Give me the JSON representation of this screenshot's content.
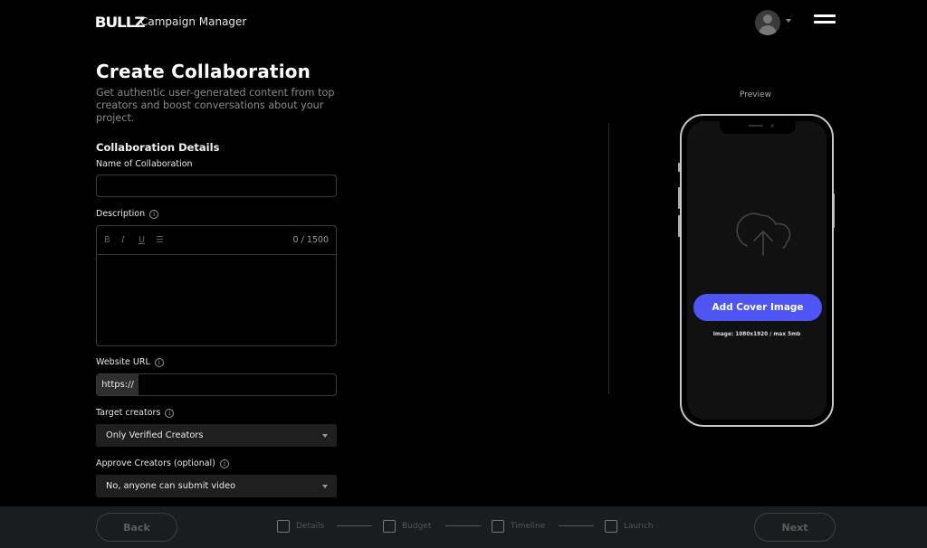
{
  "header": {
    "logo": "BULLZ",
    "app_title": "Campaign Manager"
  },
  "form": {
    "title": "Create Collaboration",
    "subtitle": "Get authentic user-generated content from top creators and boost conversations about your project.",
    "section_title": "Collaboration Details",
    "name_label": "Name of Collaboration",
    "name_value": "",
    "description_label": "Description",
    "description_toolbar": [
      "B",
      "I",
      "U",
      "☰"
    ],
    "description_counter": "0 / 1500",
    "description_value": "",
    "website_label": "Website URL",
    "website_prefix": "https://",
    "website_value": "",
    "target_label": "Target creators",
    "target_value": "Only Verified Creators",
    "approve_label": "Approve Creators (optional)",
    "approve_value": "No, anyone can submit video",
    "info_glyph": "i"
  },
  "preview": {
    "label": "Preview",
    "cover_button": "Add Cover Image",
    "cover_hint": "Image: 1080x1920 / max 5mb",
    "accent_color": "#4f55f5"
  },
  "footer": {
    "back_label": "Back",
    "next_label": "Next",
    "steps": [
      {
        "label": "Details",
        "checked": false
      },
      {
        "label": "Budget",
        "checked": false
      },
      {
        "label": "Timeline",
        "checked": false
      },
      {
        "label": "Launch",
        "checked": false
      }
    ]
  }
}
